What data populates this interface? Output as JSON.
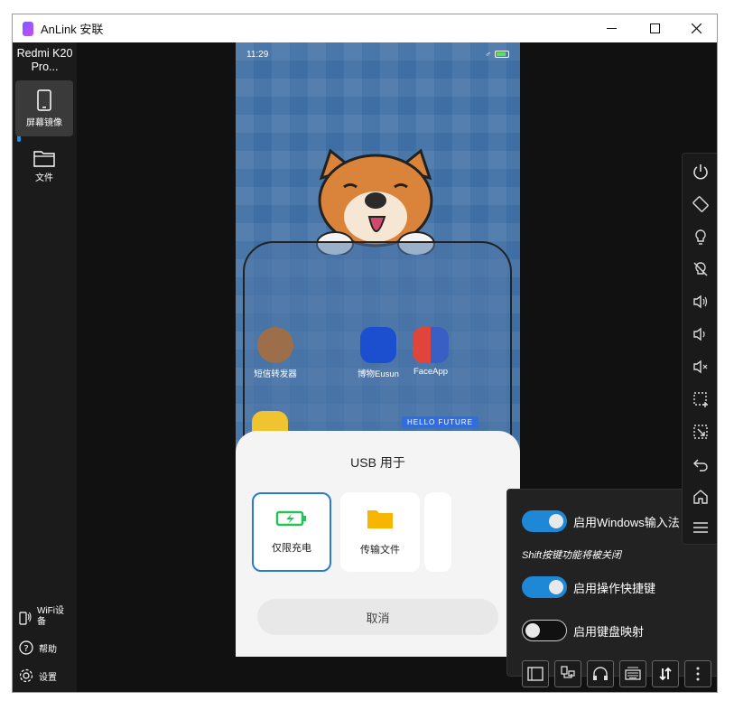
{
  "window": {
    "title": "AnLink 安联"
  },
  "sidebar": {
    "device_name": "Redmi K20 Pro...",
    "items": [
      {
        "label": "屏幕镜像",
        "icon": "phone-icon",
        "active": true
      },
      {
        "label": "文件",
        "icon": "folder-icon",
        "active": false
      }
    ],
    "bottom": [
      {
        "label": "WiFi设备",
        "icon": "wifi-phone-icon"
      },
      {
        "label": "帮助",
        "icon": "help-icon"
      },
      {
        "label": "设置",
        "icon": "settings-icon"
      }
    ]
  },
  "phone": {
    "status_time": "11:29",
    "apps": [
      {
        "label": "短信转发器"
      },
      {
        "label": "博物Eusun"
      },
      {
        "label": "FaceApp"
      }
    ],
    "banner_text": "HELLO FUTURE",
    "usb_sheet": {
      "title": "USB 用于",
      "options": [
        {
          "label": "仅限充电",
          "selected": true
        },
        {
          "label": "传输文件",
          "selected": false
        }
      ],
      "cancel": "取消"
    }
  },
  "popup": {
    "toggles": [
      {
        "label": "启用Windows输入法",
        "on": true
      },
      {
        "label": "启用操作快捷键",
        "on": true
      },
      {
        "label": "启用键盘映射",
        "on": false
      }
    ],
    "note": "Shift按键功能将被关闭"
  },
  "right_toolbar": [
    "power-icon",
    "rotate-icon",
    "light-icon",
    "light-off-icon",
    "volume-up-icon",
    "volume-down-icon",
    "mute-icon",
    "screenshot-icon",
    "crop-icon",
    "back-icon",
    "home-icon",
    "menu-icon"
  ],
  "bottom_toolbar": [
    "window-icon",
    "usb-icon",
    "headset-icon",
    "keyboard-icon",
    "transfer-icon",
    "more-icon"
  ]
}
